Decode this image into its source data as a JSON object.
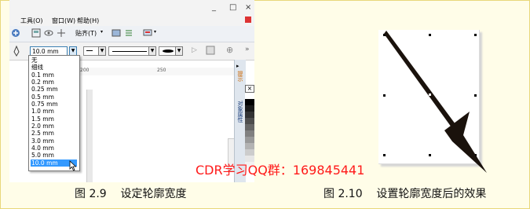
{
  "screenshot": {
    "menu": [
      "工具(O)",
      "窗口(W)",
      "帮助(H)"
    ],
    "window_buttons": [
      "_",
      "□",
      "×"
    ],
    "toolbar": {
      "snap_label": "贴齐(T)"
    },
    "width_select": {
      "value": "10.0 mm"
    },
    "dropdown_options": [
      "无",
      "细线",
      "0.1 mm",
      "0.2 mm",
      "0.25 mm",
      "0.5 mm",
      "0.75 mm",
      "1.0 mm",
      "1.5 mm",
      "2.0 mm",
      "2.5 mm",
      "3.0 mm",
      "4.0 mm",
      "5.0 mm",
      "10.0 mm"
    ],
    "selected_option": "10.0 mm",
    "ruler_ticks": [
      "200",
      "250"
    ],
    "docker_tabs": [
      "提示",
      "对象属性"
    ],
    "palette_colors": [
      "#ffffff",
      "#000000",
      "#1a1a1a",
      "#333333",
      "#4d4d4d",
      "#666666",
      "#808080",
      "#999999",
      "#b3b3b3",
      "#cccccc",
      "#e6e6e6",
      "#f2f2f2"
    ]
  },
  "captions": {
    "left": "图 2.9    设定轮廓宽度",
    "right": "图 2.10    设置轮廓宽度后的效果"
  },
  "watermark": "CDR学习QQ群：169845441",
  "colors": {
    "accent": "#3399ff",
    "watermark": "#ff1a1a",
    "border": "#e8d77a"
  }
}
